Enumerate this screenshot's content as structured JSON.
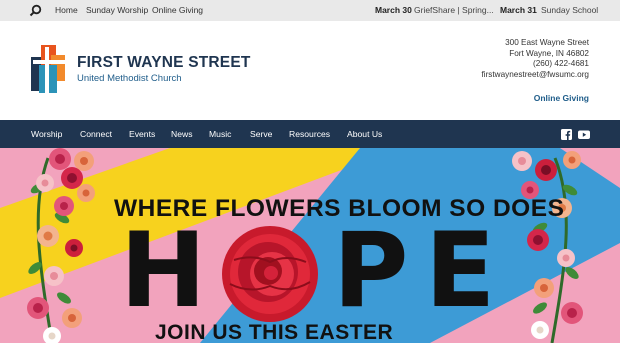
{
  "topbar": {
    "links": [
      "Home",
      "Sunday Worship",
      "Online Giving"
    ],
    "events": [
      {
        "date": "March 30",
        "title": "GriefShare | Spring..."
      },
      {
        "date": "March 31",
        "title": "Sunday School"
      }
    ]
  },
  "header": {
    "name": "FIRST WAYNE STREET",
    "subtitle": "United Methodist Church",
    "address": [
      "300 East Wayne Street",
      "Fort Wayne, IN 46802",
      "(260) 422-4681",
      "firstwaynestreet@fwsumc.org"
    ],
    "online_giving": "Online Giving"
  },
  "nav": {
    "items": [
      "Worship",
      "Connect",
      "Events",
      "News",
      "Music",
      "Serve",
      "Resources",
      "About Us"
    ]
  },
  "banner": {
    "headline": "WHERE FLOWERS BLOOM SO DOES",
    "hope_letters": [
      "H",
      "P",
      "E"
    ],
    "subline": "JOIN US THIS EASTER"
  },
  "colors": {
    "navy": "#1f3550",
    "accent_blue": "#1f5d8a",
    "banner_pink": "#f2a3bd",
    "banner_yellow": "#f7d21e",
    "banner_blue": "#3d9bd6"
  },
  "icons": [
    "search-icon",
    "facebook-icon",
    "youtube-icon"
  ]
}
